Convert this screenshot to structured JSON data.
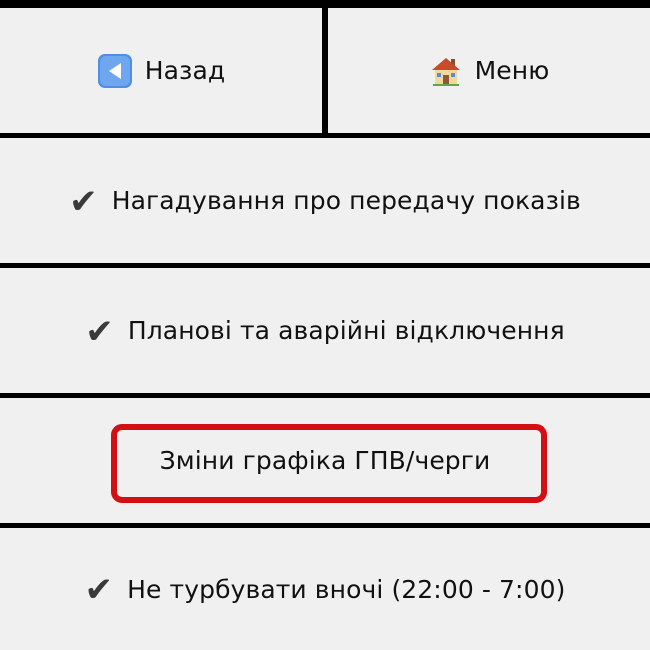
{
  "nav": {
    "back_label": "Назад",
    "back_icon": "back-arrow-icon",
    "menu_label": "Меню",
    "menu_icon": "house-icon"
  },
  "options": [
    {
      "label": "Нагадування про передачу показів",
      "checked": true
    },
    {
      "label": "Планові та аварійні відключення",
      "checked": true
    },
    {
      "label": "Зміни графіка ГПВ/черги",
      "checked": false
    },
    {
      "label": "Не турбувати вночі (22:00 - 7:00)",
      "checked": true
    }
  ],
  "check_glyph": "✔",
  "colors": {
    "button_bg": "#f0f0f0",
    "divider": "#000000",
    "highlight": "#d40f14",
    "back_icon_bg": "#4f8fe3"
  }
}
